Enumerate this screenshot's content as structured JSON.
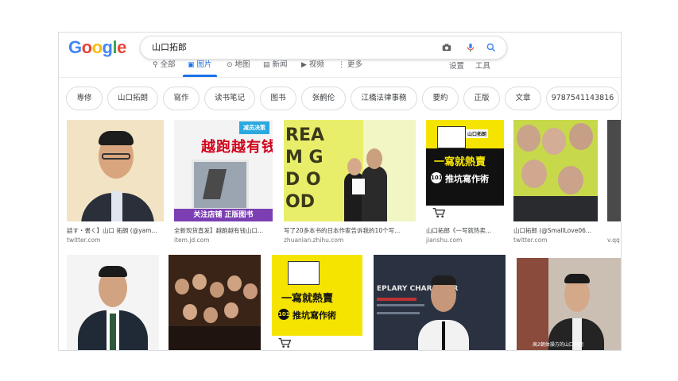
{
  "search": {
    "query": "山口拓郎"
  },
  "tabs": [
    {
      "label": "全部",
      "icon": "search-icon"
    },
    {
      "label": "图片",
      "icon": "image-icon",
      "active": true
    },
    {
      "label": "地图",
      "icon": "map-pin-icon"
    },
    {
      "label": "新闻",
      "icon": "news-icon"
    },
    {
      "label": "视频",
      "icon": "video-icon"
    },
    {
      "label": "更多",
      "icon": "more-vert-icon"
    }
  ],
  "tools": {
    "settings": "设置",
    "tools": "工具"
  },
  "chips": [
    "専修",
    "山口拓朗",
    "寫作",
    "读书笔记",
    "图书",
    "张鹤伦",
    "江橋法律事務",
    "要約",
    "正版",
    "文章",
    "9787541143816"
  ],
  "results_row1": [
    {
      "caption": "話す・書く】山口 拓朗 (@yam...",
      "source": "twitter.com"
    },
    {
      "caption": "全新现货直发】越跑越有钱山口...",
      "source": "item.jd.com",
      "img_title": "越跑越有钱",
      "img_banner": "关注店铺 正版图书",
      "img_tag": "减员决策"
    },
    {
      "caption": "写了20多本书的日本作家告诉我的10个写...",
      "source": "zhuanlan.zhihu.com",
      "img_text": "REAM G D OOD"
    },
    {
      "caption": "山口拓郎《一写就热卖...",
      "source": "jianshu.com",
      "img_title": "一寫就熱賣",
      "img_sub": "推坑寫作術",
      "img_num": "101",
      "img_brand": "山口拓朗"
    },
    {
      "caption": "山口拓郎 (@SmallLove06...",
      "source": "twitter.com"
    },
    {
      "caption": "",
      "source": "v.qq"
    }
  ],
  "results_row2": [
    {
      "caption": "",
      "source": ""
    },
    {
      "caption": "",
      "source": ""
    },
    {
      "caption": "",
      "source": "",
      "img_title": "一寫就熱賣",
      "img_sub": "推坑寫作術",
      "img_num": "101"
    },
    {
      "caption": "",
      "source": "",
      "img_text": "EPLARY CHARACTER"
    },
    {
      "caption": "",
      "source": "",
      "img_caption": "高2朝体操方的山口拓朗"
    }
  ],
  "colors": {
    "accent": "#1a73e8",
    "chip_border": "#dadce0",
    "yellow": "#f5e400",
    "lime": "#d8e84a"
  }
}
